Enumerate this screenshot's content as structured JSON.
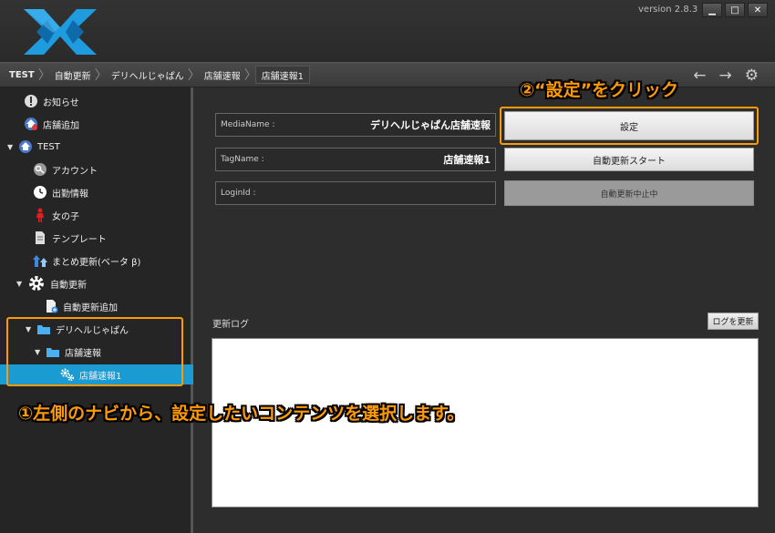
{
  "window": {
    "version": "version 2.8.3",
    "controls": {
      "minimize": "▁",
      "maximize": "□",
      "close": "✕"
    }
  },
  "breadcrumb": [
    "TEST",
    "自動更新",
    "デリヘルじゃぱん",
    "店舗速報",
    "店舗速報1"
  ],
  "sidebar": {
    "items": [
      {
        "label": "お知らせ",
        "icon": "exclamation-icon"
      },
      {
        "label": "店舗追加",
        "icon": "home-add-icon"
      },
      {
        "label": "TEST",
        "icon": "home-icon"
      },
      {
        "label": "アカウント",
        "icon": "key-icon"
      },
      {
        "label": "出勤情報",
        "icon": "clock-icon"
      },
      {
        "label": "女の子",
        "icon": "person-icon"
      },
      {
        "label": "テンプレート",
        "icon": "document-icon"
      },
      {
        "label": "まとめ更新(ベータ β)",
        "icon": "up-arrows-icon"
      },
      {
        "label": "自動更新",
        "icon": "gear-icon"
      },
      {
        "label": "自動更新追加",
        "icon": "add-file-icon"
      },
      {
        "label": "デリヘルじゃぱん",
        "icon": "folder-icon"
      },
      {
        "label": "店舗速報",
        "icon": "folder-icon"
      },
      {
        "label": "店舗速報1",
        "icon": "gears-icon"
      }
    ]
  },
  "main": {
    "fields": [
      {
        "label": "MediaName :",
        "value": "デリヘルじゃぱん店舗速報"
      },
      {
        "label": "TagName :",
        "value": "店舗速報1"
      },
      {
        "label": "LoginId :",
        "value": ""
      }
    ],
    "buttons": {
      "settings": "設定",
      "auto_start": "自動更新スタート",
      "auto_stopped": "自動更新中止中"
    },
    "log": {
      "label": "更新ログ",
      "refresh": "ログを更新"
    }
  },
  "annotations": {
    "step2": "②“設定”をクリック",
    "step1": "①左側のナビから、設定したいコンテンツを選択します。"
  },
  "colors": {
    "accent_orange": "#ff9a00",
    "selected_blue": "#1a9bd1",
    "logo_blue": "#1f9be0"
  }
}
